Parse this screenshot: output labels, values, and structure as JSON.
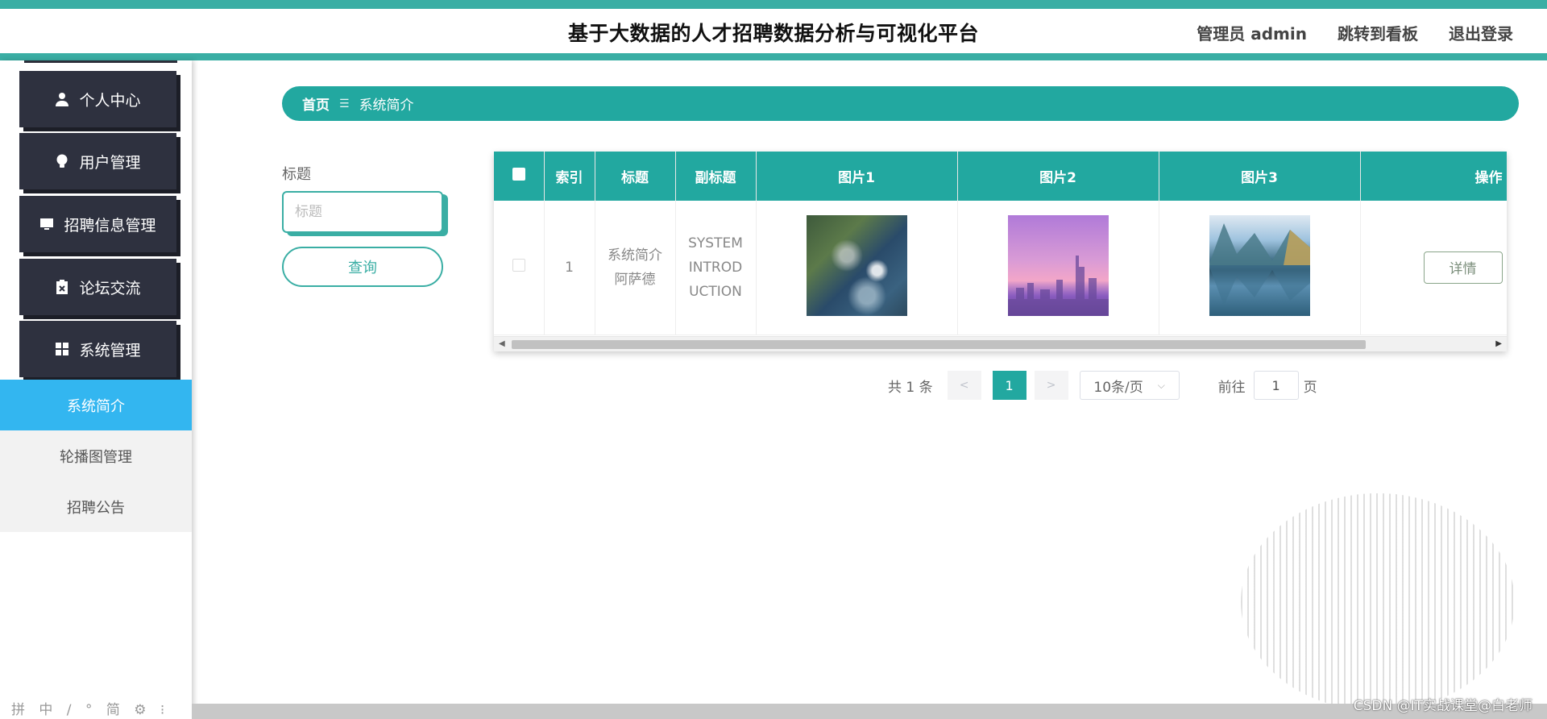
{
  "header": {
    "title": "基于大数据的人才招聘数据分析与可视化平台",
    "user": "管理员 admin",
    "dashboard_link": "跳转到看板",
    "logout_link": "退出登录",
    "accent_color": "#3aaea4"
  },
  "sidebar": {
    "items": [
      {
        "label": "个人中心",
        "icon": "person-icon"
      },
      {
        "label": "用户管理",
        "icon": "lightbulb-icon"
      },
      {
        "label": "招聘信息管理",
        "icon": "monitor-icon"
      },
      {
        "label": "论坛交流",
        "icon": "clipboard-icon"
      },
      {
        "label": "系统管理",
        "icon": "grid-icon"
      }
    ],
    "submenu": [
      {
        "label": "系统简介",
        "active": true
      },
      {
        "label": "轮播图管理",
        "active": false
      },
      {
        "label": "招聘公告",
        "active": false
      }
    ],
    "ime_text": "拼 中 ∕ ° 简 ⚙ ⁝"
  },
  "breadcrumb": {
    "home": "首页",
    "separator": "☰",
    "current": "系统简介"
  },
  "search": {
    "label": "标题",
    "placeholder": "标题",
    "value": "",
    "button": "查询"
  },
  "table": {
    "columns": [
      "索引",
      "标题",
      "副标题",
      "图片1",
      "图片2",
      "图片3",
      "操作"
    ],
    "rows": [
      {
        "index": "1",
        "title": "系统简介阿萨德",
        "subtitle": "SYSTEM INTRODUCTION",
        "image1": "satellite-weather-image",
        "image2": "pink-city-skyline-image",
        "image3": "mountain-lake-image",
        "action": "详情"
      }
    ]
  },
  "pagination": {
    "total": "共 1 条",
    "prev": "<",
    "current_page": "1",
    "next": ">",
    "page_size": "10条/页",
    "goto_label": "前往",
    "goto_value": "1",
    "page_suffix": "页"
  },
  "watermark": "CSDN @IT实战课堂@白老师"
}
